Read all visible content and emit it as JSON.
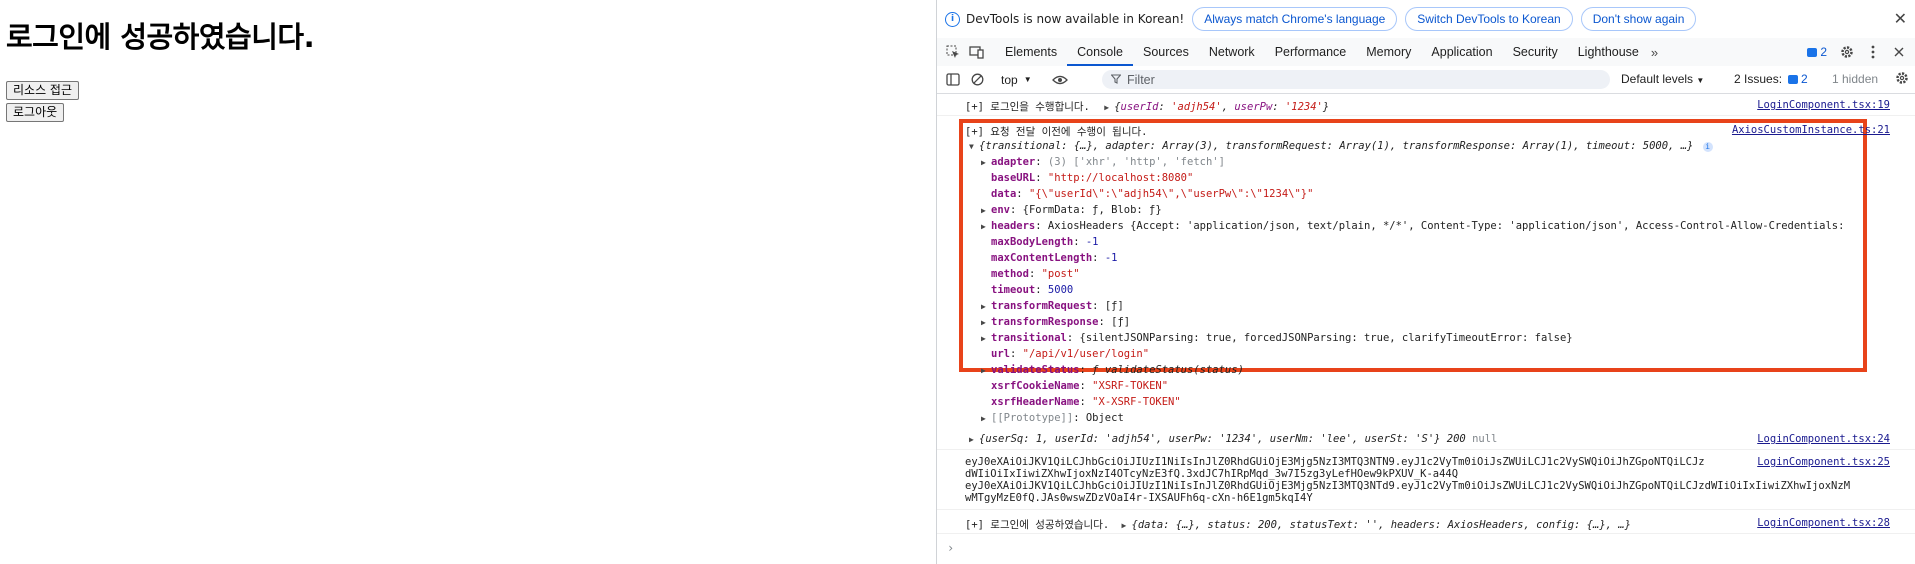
{
  "app": {
    "heading": "로그인에 성공하였습니다.",
    "buttons": {
      "resource": "리소스 접근",
      "logout": "로그아웃"
    }
  },
  "devtools": {
    "infobar": {
      "message": "DevTools is now available in Korean!",
      "btn_match": "Always match Chrome's language",
      "btn_switch": "Switch DevTools to Korean",
      "btn_dont": "Don't show again",
      "close": "✕"
    },
    "tabs": [
      "Elements",
      "Console",
      "Sources",
      "Network",
      "Performance",
      "Memory",
      "Application",
      "Security",
      "Lighthouse"
    ],
    "active_tab": "Console",
    "tab_more": "»",
    "badge_count": "2",
    "toolbar": {
      "context": "top",
      "filter_placeholder": "Filter",
      "levels": "Default levels",
      "issues_label": "2 Issues:",
      "issues_count": "2",
      "hidden": "1 hidden"
    },
    "console": {
      "line1": {
        "prefix": "[+] 로그인을 수행합니다.",
        "obj_open": "{",
        "k1": "userId",
        "v1": "'adjh54'",
        "k2": "userPw",
        "v2": "'1234'",
        "obj_close": "}",
        "src": "LoginComponent.tsx:19"
      },
      "line2": {
        "text": "[+] 요청 전달 이전에 수행이 됩니다.",
        "src": "AxiosCustomInstance.ts:21"
      },
      "summary": "{transitional: {…}, adapter: Array(3), transformRequest: Array(1), transformResponse: Array(1), timeout: 5000, …}",
      "props": {
        "adapter_key": "adapter",
        "adapter_val": "(3) ['xhr', 'http', 'fetch']",
        "baseURL_key": "baseURL",
        "baseURL_val": "\"http://localhost:8080\"",
        "data_key": "data",
        "data_val": "\"{\\\"userId\\\":\\\"adjh54\\\",\\\"userPw\\\":\\\"1234\\\"}\"",
        "env_key": "env",
        "env_val": "{FormData: ƒ, Blob: ƒ}",
        "headers_key": "headers",
        "headers_val": "AxiosHeaders {Accept: 'application/json, text/plain, */*', Content-Type: 'application/json', Access-Control-Allow-Credentials:",
        "maxBodyLength_key": "maxBodyLength",
        "maxBodyLength_val": "-1",
        "maxContentLength_key": "maxContentLength",
        "maxContentLength_val": "-1",
        "method_key": "method",
        "method_val": "\"post\"",
        "timeout_key": "timeout",
        "timeout_val": "5000",
        "transformRequest_key": "transformRequest",
        "transformRequest_val": "[ƒ]",
        "transformResponse_key": "transformResponse",
        "transformResponse_val": "[ƒ]",
        "transitional_key": "transitional",
        "transitional_val": "{silentJSONParsing: true, forcedJSONParsing: true, clarifyTimeoutError: false}",
        "url_key": "url",
        "url_val": "\"/api/v1/user/login\"",
        "validateStatus_key": "validateStatus",
        "validateStatus_val": "ƒ validateStatus(status)",
        "xsrfCookieName_key": "xsrfCookieName",
        "xsrfCookieName_val": "\"XSRF-TOKEN\"",
        "xsrfHeaderName_key": "xsrfHeaderName",
        "xsrfHeaderName_val": "\"X-XSRF-TOKEN\"",
        "prototype_key": "[[Prototype]]",
        "prototype_val": "Object"
      },
      "line3": {
        "text": "{userSq: 1, userId: 'adjh54', userPw: '1234', userNm: 'lee', userSt: 'S'} 200",
        "null_text": "null",
        "src": "LoginComponent.tsx:24"
      },
      "token1_a": "eyJ0eXAiOiJKV1QiLCJhbGciOiJIUzI1NiIsInJlZ0RhdGUiOjE3Mjg5NzI3MTQ3NTN9.eyJ1c2VyTm0iOiJsZWUiLCJ1c2VySWQiOiJhZGpoNTQiLCJz",
      "token1_b": "dWIiOiIxIiwiZXhwIjoxNzI4OTcyNzE3fQ.3xdJC7hIRpMqd_3w7I5zg3yLefHOew9kPXUV_K-a44Q",
      "token1_src": "LoginComponent.tsx:25",
      "token2_a": "eyJ0eXAiOiJKV1QiLCJhbGciOiJIUzI1NiIsInJlZ0RhdGUiOjE3Mjg5NzI3MTQ3NTd9.eyJ1c2VyTm0iOiJsZWUiLCJ1c2VySWQiOiJhZGpoNTQiLCJzdWIiOiIxIiwiZXhwIjoxNzM",
      "token2_b": "wMTgyMzE0fQ.JAs0wswZDzVOaI4r-IXSAUFh6q-cXn-h6E1gm5kqI4Y",
      "line4": {
        "prefix": "[+] 로그인에 성공하였습니다.",
        "obj": "{data: {…}, status: 200, statusText: '', headers: AxiosHeaders, config: {…}, …}",
        "src": "LoginComponent.tsx:28"
      },
      "prompt": "›"
    }
  }
}
